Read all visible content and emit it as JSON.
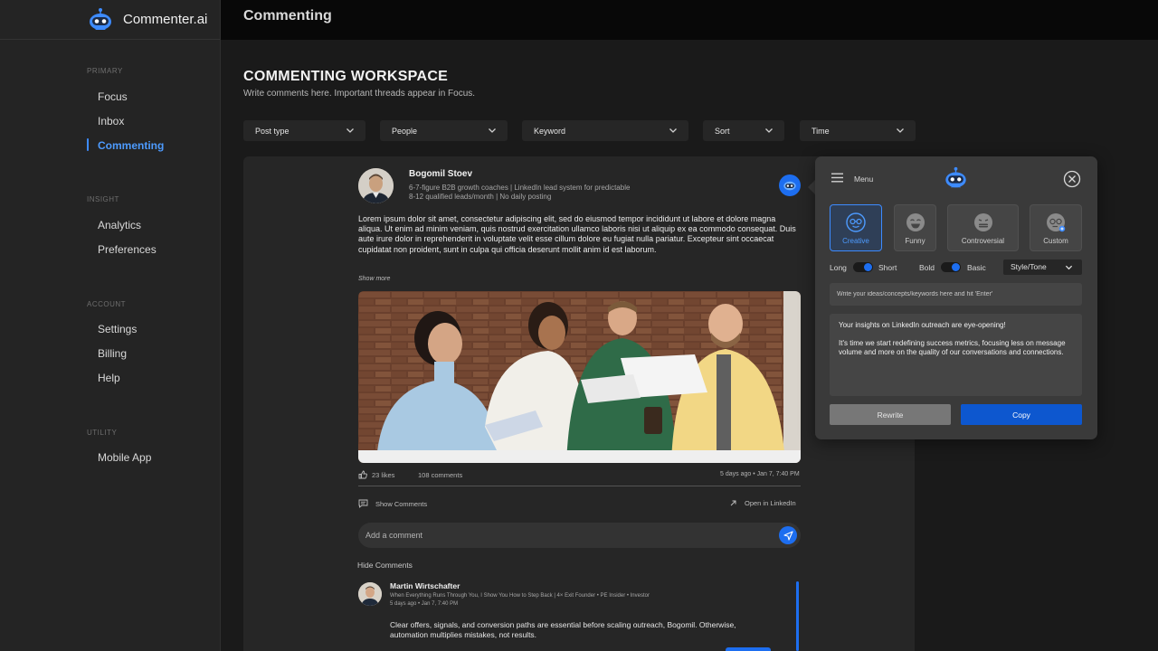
{
  "brand": {
    "name": "Commenter.ai"
  },
  "sidebar": {
    "sections": [
      {
        "label": "PRIMARY",
        "items": [
          {
            "label": "Focus"
          },
          {
            "label": "Inbox"
          },
          {
            "label": "Commenting"
          }
        ]
      },
      {
        "label": "INSIGHT",
        "items": [
          {
            "label": "Analytics"
          },
          {
            "label": "Preferences"
          }
        ]
      },
      {
        "label": "ACCOUNT",
        "items": [
          {
            "label": "Settings"
          },
          {
            "label": "Billing"
          },
          {
            "label": "Help"
          }
        ]
      },
      {
        "label": "UTILITY",
        "items": [
          {
            "label": "Mobile App"
          }
        ]
      }
    ],
    "active": "Commenting"
  },
  "topbar": {
    "title": "Commenting"
  },
  "workspace": {
    "title": "COMMENTING WORKSPACE",
    "subtitle": "Write comments here. Important threads appear in Focus."
  },
  "filters": [
    "Post type",
    "People",
    "Keyword",
    "Sort",
    "Time"
  ],
  "post": {
    "author": "Bogomil Stoev",
    "headline": "6-7-figure B2B growth coaches | LinkedIn lead system for predictable 8-12 qualified leads/month | No daily posting",
    "body": "Lorem ipsum dolor sit amet, consectetur adipiscing elit, sed do eiusmod tempor incididunt ut labore et dolore magna aliqua. Ut enim ad minim veniam, quis nostrud exercitation ullamco laboris nisi ut aliquip ex ea commodo consequat. Duis aute irure dolor in reprehenderit in voluptate velit esse cillum dolore eu fugiat nulla pariatur. Excepteur sint occaecat cupidatat non proident, sunt in culpa qui officia deserunt mollit anim id est laborum.",
    "show_more": "Show more",
    "likes": "23 likes",
    "comments": "108 comments",
    "time": "5 days ago • Jan 7, 7:40 PM",
    "show_comments": "Show Comments",
    "open_linkedin": "Open in LinkedIn",
    "comment_placeholder": "Add a comment",
    "hide_comments": "Hide Comments"
  },
  "comment": {
    "author": "Martin Wirtschafter",
    "headline": "When Everything Runs Through You, I Show You How to Step Back | 4× Exit Founder • PE Insider • Investor",
    "time": "5 days ago • Jan 7, 7:40 PM",
    "body": "Clear offers, signals, and conversion paths are essential before scaling outreach, Bogomil. Otherwise, automation multiplies mistakes, not results."
  },
  "panel": {
    "menu_label": "Menu",
    "tones": [
      "Creative",
      "Funny",
      "Controversial",
      "Custom"
    ],
    "active_tone": "Creative",
    "length": {
      "left": "Long",
      "right": "Short",
      "selected": "Short"
    },
    "style": {
      "left": "Bold",
      "right": "Basic",
      "selected": "Basic"
    },
    "style_tone": "Style/Tone",
    "ideas_placeholder": "Write your ideas/concepts/keywords here and hit 'Enter'",
    "output_p1": "Your insights on LinkedIn outreach are eye-opening!",
    "output_p2": "It's time we start redefining success metrics, focusing less on message volume and more on the quality of our conversations and connections.",
    "rewrite": "Rewrite",
    "copy": "Copy"
  },
  "colors": {
    "accent": "#1d6ef0",
    "active_nav": "#4d9bff",
    "panel": "#3a3a3a"
  }
}
